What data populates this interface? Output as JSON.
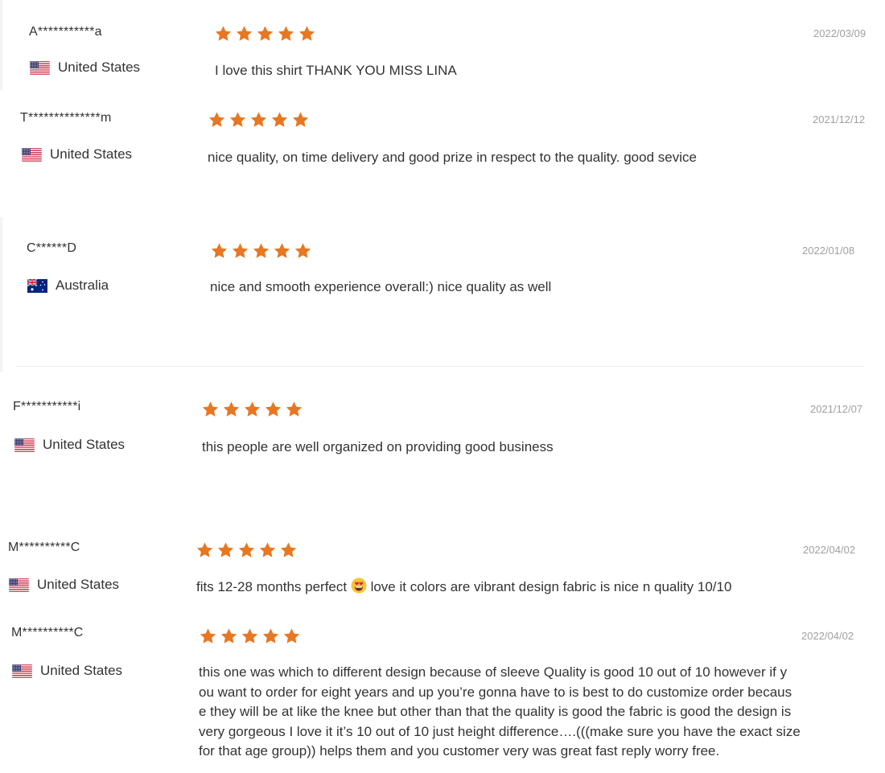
{
  "colors": {
    "star": "#e87722",
    "date": "#a0a0a0",
    "text": "#333333"
  },
  "reviews": [
    {
      "user": "A***********a",
      "country": "United States",
      "flag": "us-flag-icon",
      "rating": 5,
      "date": "2022/03/09",
      "text": "I love this shirt THANK YOU MISS LINA"
    },
    {
      "user": "T**************m",
      "country": "United States",
      "flag": "us-flag-icon",
      "rating": 5,
      "date": "2021/12/12",
      "text": "nice quality, on time delivery and good prize in respect to the quality. good sevice"
    },
    {
      "user": "C******D",
      "country": "Australia",
      "flag": "au-flag-icon",
      "rating": 5,
      "date": "2022/01/08",
      "text": "nice and smooth experience overall:) nice quality as well"
    },
    {
      "user": "F***********i",
      "country": "United States",
      "flag": "us-flag-icon",
      "rating": 5,
      "date": "2021/12/07",
      "text": "this people are well organized on providing good business"
    },
    {
      "user": "M**********C",
      "country": "United States",
      "flag": "us-flag-icon",
      "rating": 5,
      "date": "2022/04/02",
      "text_before": "fits 12-28 months perfect",
      "emoji": "heart-eyes-emoji-icon",
      "text_after": "love it colors are vibrant design fabric is nice n quality 10/10"
    },
    {
      "user": "M**********C",
      "country": "United States",
      "flag": "us-flag-icon",
      "rating": 5,
      "date": "2022/04/02",
      "text": "this one was which to different design because of sleeve Quality is good 10 out of 10 however if y\nou want to order for eight years and up you’re gonna have to is best to do customize order becaus\ne they will be at like the knee but other than that the quality is good the fabric is good the design is\nvery gorgeous I love it it’s 10 out of 10 just height difference….(((make sure you have the exact size\nfor that age group)) helps them and you customer very was great fast reply worry free."
    }
  ]
}
